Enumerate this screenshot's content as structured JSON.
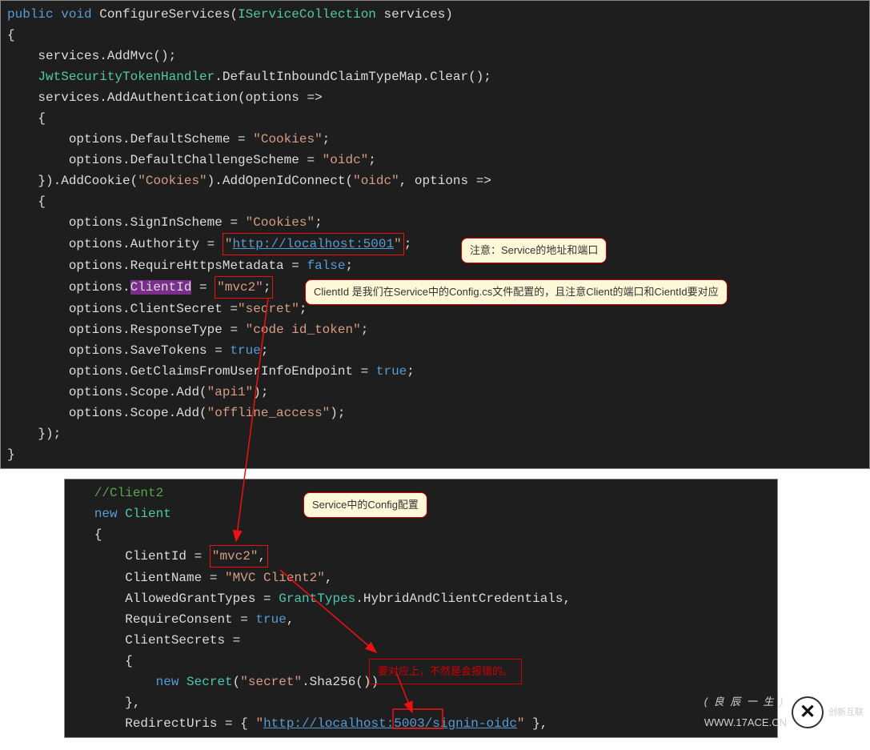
{
  "block1": {
    "l1_public": "public",
    "l1_void": "void",
    "l1_method": " ConfigureServices(",
    "l1_paramtype": "IServiceCollection",
    "l1_param": " services)",
    "l2": "{",
    "l3": "    services.AddMvc();",
    "l4_type": "JwtSecurityTokenHandler",
    "l4_rest": ".DefaultInboundClaimTypeMap.Clear();",
    "l5": "    services.AddAuthentication(options =>",
    "l6": "    {",
    "l7_a": "        options.DefaultScheme = ",
    "l7_str": "\"Cookies\"",
    "l7_end": ";",
    "l8_a": "        options.DefaultChallengeScheme = ",
    "l8_str": "\"oidc\"",
    "l8_end": ";",
    "l9_a": "    }).AddCookie(",
    "l9_str1": "\"Cookies\"",
    "l9_b": ").AddOpenIdConnect(",
    "l9_str2": "\"oidc\"",
    "l9_c": ", options =>",
    "l10": "    {",
    "l11_a": "        options.SignInScheme = ",
    "l11_str": "\"Cookies\"",
    "l11_end": ";",
    "l12_a": "        options.Authority = ",
    "l12_q1": "\"",
    "l12_url": "http://localhost:5001",
    "l12_q2": "\"",
    "l12_end": ";",
    "l13_a": "        options.RequireHttpsMetadata = ",
    "l13_kw": "false",
    "l13_end": ";",
    "l14_a": "        options.",
    "l14_hl": "ClientId",
    "l14_eq": " = ",
    "l14_str": "\"mvc2\"",
    "l14_end": ";",
    "l15_a": "        options.ClientSecret =",
    "l15_str": "\"secret\"",
    "l15_end": ";",
    "l16_a": "        options.ResponseType = ",
    "l16_str": "\"code id_token\"",
    "l16_end": ";",
    "l17_a": "        options.SaveTokens = ",
    "l17_kw": "true",
    "l17_end": ";",
    "l18_a": "        options.GetClaimsFromUserInfoEndpoint = ",
    "l18_kw": "true",
    "l18_end": ";",
    "l19_a": "        options.Scope.Add(",
    "l19_str": "\"api1\"",
    "l19_end": ");",
    "l20_a": "        options.Scope.Add(",
    "l20_str": "\"offline_access\"",
    "l20_end": ");",
    "l21": "    });",
    "l22": "}"
  },
  "block2": {
    "c1": "   //Client2",
    "n2_new": "new",
    "n2_type": "Client",
    "n3": "{",
    "n4_a": "    ClientId = ",
    "n4_str": "\"mvc2\"",
    "n4_end": ",",
    "n5_a": "    ClientName = ",
    "n5_str": "\"MVC Client2\"",
    "n5_end": ",",
    "n6_a": "    AllowedGrantTypes = ",
    "n6_type": "GrantTypes",
    "n6_rest": ".HybridAndClientCredentials,",
    "n7_a": "    RequireConsent = ",
    "n7_kw": "true",
    "n7_end": ",",
    "n8": "    ClientSecrets =",
    "n9": "    {",
    "n10_new": "new",
    "n10_type": "Secret",
    "n10_open": "(",
    "n10_str": "\"secret\"",
    "n10_rest": ".Sha256())",
    "n11": "    },",
    "n12_a": "    RedirectUris = { ",
    "n12_q1": "\"",
    "n12_url": "http://localhost:5003/signin-oidc",
    "n12_q2": "\"",
    "n12_end": " },"
  },
  "notes": {
    "n1": "注意：Service的地址和端口",
    "n2": "ClientId 是我们在Service中的Config.cs文件配置的，且注意Client的端口和CientId要对应",
    "n3": "Service中的Config配置",
    "n4": "要对应上，不然是会报错的。"
  },
  "watermark": {
    "top": "( 良 辰 一 生 )",
    "bottom": "WWW.17ACE.CN",
    "logo": "创新互联"
  }
}
